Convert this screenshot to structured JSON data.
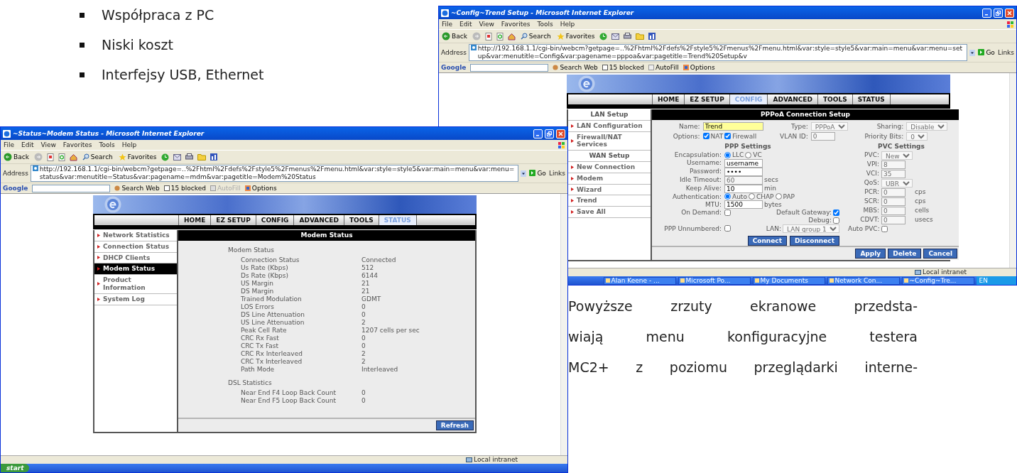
{
  "bullets": [
    "Współpraca z PC",
    "Niski koszt",
    "Interfejsy USB, Ethernet"
  ],
  "config_window": {
    "title": "~Config~Trend Setup - Microsoft Internet Explorer",
    "menu": [
      "File",
      "Edit",
      "View",
      "Favorites",
      "Tools",
      "Help"
    ],
    "toolbar": [
      "Back",
      "Search",
      "Favorites"
    ],
    "address_label": "Address",
    "address": "http://192.168.1.1/cgi-bin/webcm?getpage=..%2Fhtml%2Fdefs%2Fstyle5%2Fmenus%2Fmenu.html&var:style=style5&var:main=menu&var:menu=setup&var:menutitle=Config&var:pagename=pppoa&var:pagetitle=Trend%20Setup&v",
    "go": "Go",
    "links": "Links",
    "google": {
      "logo": "Google",
      "search_web": "Search Web",
      "blocked": "15 blocked",
      "autofill": "AutoFill",
      "autofill_disabled": false,
      "options": "Options"
    },
    "tabs": [
      {
        "label": "HOME",
        "selected": false
      },
      {
        "label": "EZ SETUP",
        "selected": false
      },
      {
        "label": "CONFIG",
        "selected": true
      },
      {
        "label": "ADVANCED",
        "selected": false
      },
      {
        "label": "TOOLS",
        "selected": false
      },
      {
        "label": "STATUS",
        "selected": false
      }
    ],
    "side_menu": [
      {
        "kind": "heading",
        "label": "LAN Setup"
      },
      {
        "kind": "link",
        "label": "LAN Configuration"
      },
      {
        "kind": "link",
        "label": "Firewall/NAT Services"
      },
      {
        "kind": "heading",
        "label": "WAN Setup"
      },
      {
        "kind": "link",
        "label": "New Connection"
      },
      {
        "kind": "link",
        "label": "Modem"
      },
      {
        "kind": "link",
        "label": "Wizard"
      },
      {
        "kind": "link",
        "label": "Trend"
      },
      {
        "kind": "link",
        "label": "Save All"
      }
    ],
    "panel_title": "PPPoA Connection Setup",
    "top_fields": [
      {
        "label": "Name:",
        "kind": "text",
        "value": "Trend",
        "disabled": false,
        "highlighted": true
      },
      {
        "label": "Type:",
        "kind": "select",
        "value": "PPPoA",
        "disabled": true
      },
      {
        "label": "Sharing:",
        "kind": "select",
        "value": "Disable",
        "disabled": true
      },
      {
        "label": "Options:",
        "kind": "checks",
        "options": [
          {
            "label": "NAT",
            "checked": true
          },
          {
            "label": "Firewall",
            "checked": true
          }
        ]
      },
      {
        "label": "VLAN ID:",
        "kind": "text",
        "value": "0",
        "disabled": true,
        "highlighted": false
      },
      {
        "label": "Priority Bits:",
        "kind": "select",
        "value": "0",
        "disabled": true
      }
    ],
    "ppp_title": "PPP Settings",
    "ppp_rows": [
      {
        "kind": "row",
        "fields": [
          {
            "label": "Encapsulation:",
            "kind": "radio",
            "options": [
              {
                "label": "LLC",
                "selected": true
              },
              {
                "label": "VC",
                "selected": false
              }
            ]
          }
        ]
      },
      {
        "kind": "row",
        "fields": [
          {
            "label": "Username:",
            "kind": "text",
            "value": "username",
            "disabled": false
          }
        ]
      },
      {
        "kind": "row",
        "fields": [
          {
            "label": "Password:",
            "kind": "text",
            "value": "••••",
            "disabled": false
          }
        ]
      },
      {
        "kind": "row",
        "fields": [
          {
            "label": "Idle Timeout:",
            "kind": "text",
            "value": "60",
            "disabled": true,
            "unit": "secs"
          }
        ]
      },
      {
        "kind": "row",
        "fields": [
          {
            "label": "Keep Alive:",
            "kind": "text",
            "value": "10",
            "disabled": false,
            "unit": "min"
          }
        ]
      },
      {
        "kind": "row",
        "fields": [
          {
            "label": "Authentication:",
            "kind": "radio",
            "options": [
              {
                "label": "Auto",
                "selected": true
              },
              {
                "label": "CHAP",
                "selected": false
              },
              {
                "label": "PAP",
                "selected": false
              }
            ]
          }
        ]
      },
      {
        "kind": "row",
        "fields": [
          {
            "label": "MTU:",
            "kind": "text",
            "value": "1500",
            "disabled": false,
            "unit": "bytes"
          }
        ]
      },
      {
        "kind": "row",
        "fields": [
          {
            "label": "On Demand:",
            "kind": "checkbox",
            "checked": false
          },
          {
            "label": "Default Gateway:",
            "kind": "checkbox",
            "checked": true
          }
        ]
      },
      {
        "kind": "continuation",
        "fields": [
          {
            "label": "Debug:",
            "kind": "checkbox",
            "checked": false
          }
        ]
      },
      {
        "kind": "row",
        "fields": [
          {
            "label": "PPP Unnumbered:",
            "kind": "checkbox",
            "checked": false
          },
          {
            "label": "LAN:",
            "kind": "select",
            "value": "LAN group 1",
            "disabled": true
          }
        ]
      }
    ],
    "pvc_title": "PVC Settings",
    "pvc_fields": [
      {
        "label": "PVC:",
        "kind": "select",
        "value": "New",
        "disabled": true
      },
      {
        "label": "VPI:",
        "kind": "text",
        "value": "8",
        "disabled": true
      },
      {
        "label": "VCI:",
        "kind": "text",
        "value": "35",
        "disabled": true
      },
      {
        "label": "QoS:",
        "kind": "select",
        "value": "UBR",
        "disabled": true
      },
      {
        "label": "PCR:",
        "kind": "text",
        "value": "0",
        "disabled": true,
        "unit": "cps"
      },
      {
        "label": "SCR:",
        "kind": "text",
        "value": "0",
        "disabled": true,
        "unit": "cps"
      },
      {
        "label": "MBS:",
        "kind": "text",
        "value": "0",
        "disabled": true,
        "unit": "cells"
      },
      {
        "label": "CDVT:",
        "kind": "text",
        "value": "0",
        "disabled": true,
        "unit": "usecs"
      },
      {
        "label": "Auto PVC:",
        "kind": "checkbox",
        "checked": false
      }
    ],
    "inner_buttons": [
      "Connect",
      "Disconnect"
    ],
    "footer_buttons": [
      "Apply",
      "Delete",
      "Cancel"
    ],
    "status": "Local intranet",
    "taskbar": {
      "items": [
        "Alan Keene - ...",
        "Microsoft Po...",
        "My Documents",
        "Network Con...",
        "~Config~Tre..."
      ],
      "tray": "EN"
    }
  },
  "status_window": {
    "title": "~Status~Modem Status - Microsoft Internet Explorer",
    "menu": [
      "File",
      "Edit",
      "View",
      "Favorites",
      "Tools",
      "Help"
    ],
    "toolbar": [
      "Back",
      "Search",
      "Favorites"
    ],
    "address_label": "Address",
    "address": "http://192.168.1.1/cgi-bin/webcm?getpage=..%2Fhtml%2Fdefs%2Fstyle5%2Fmenus%2Fmenu.html&var:style=style5&var:main=menu&var:menu=status&var:menutitle=Status&var:pagename=mdm&var:pagetitle=Modem%20Status",
    "go": "Go",
    "links": "Links",
    "google": {
      "logo": "Google",
      "search_web": "Search Web",
      "blocked": "15 blocked",
      "autofill": "AutoFill",
      "autofill_disabled": true,
      "options": "Options"
    },
    "tabs": [
      {
        "label": "HOME",
        "selected": false
      },
      {
        "label": "EZ SETUP",
        "selected": false
      },
      {
        "label": "CONFIG",
        "selected": false
      },
      {
        "label": "ADVANCED",
        "selected": false
      },
      {
        "label": "TOOLS",
        "selected": false
      },
      {
        "label": "STATUS",
        "selected": true
      }
    ],
    "side_menu": [
      {
        "kind": "link",
        "label": "Network Statistics",
        "selected": false
      },
      {
        "kind": "link",
        "label": "Connection Status",
        "selected": false
      },
      {
        "kind": "link",
        "label": "DHCP Clients",
        "selected": false
      },
      {
        "kind": "link",
        "label": "Modem Status",
        "selected": true
      },
      {
        "kind": "link",
        "label": "Product Information",
        "selected": false
      },
      {
        "kind": "link",
        "label": "System Log",
        "selected": false
      }
    ],
    "panel_title": "Modem Status",
    "groups": [
      {
        "title": "Modem Status",
        "rows": [
          [
            "Connection Status",
            "Connected"
          ],
          [
            "Us Rate (Kbps)",
            "512"
          ],
          [
            "Ds Rate (Kbps)",
            "6144"
          ],
          [
            "US Margin",
            "21"
          ],
          [
            "DS Margin",
            "21"
          ],
          [
            "Trained Modulation",
            "GDMT"
          ],
          [
            "LOS Errors",
            "0"
          ],
          [
            "DS Line Attenuation",
            "0"
          ],
          [
            "US Line Attenuation",
            "2"
          ],
          [
            "Peak Cell Rate",
            "1207 cells per sec"
          ],
          [
            "CRC Rx Fast",
            "0"
          ],
          [
            "CRC Tx Fast",
            "0"
          ],
          [
            "CRC Rx Interleaved",
            "2"
          ],
          [
            "CRC Tx Interleaved",
            "2"
          ],
          [
            "Path Mode",
            "Interleaved"
          ]
        ]
      },
      {
        "title": "DSL Statistics",
        "rows": [
          [
            "Near End F4 Loop Back Count",
            "0"
          ],
          [
            "Near End F5 Loop Back Count",
            "0"
          ]
        ]
      }
    ],
    "footer_buttons": [
      "Refresh"
    ],
    "status": "Local intranet",
    "taskbar": {
      "start": "start"
    }
  },
  "paragraph_lines": [
    "Powyższe zrzuty ekranowe przedsta-",
    "wiają menu konfiguracyjne testera",
    "MC2+ z poziomu przeglądarki interne-"
  ]
}
